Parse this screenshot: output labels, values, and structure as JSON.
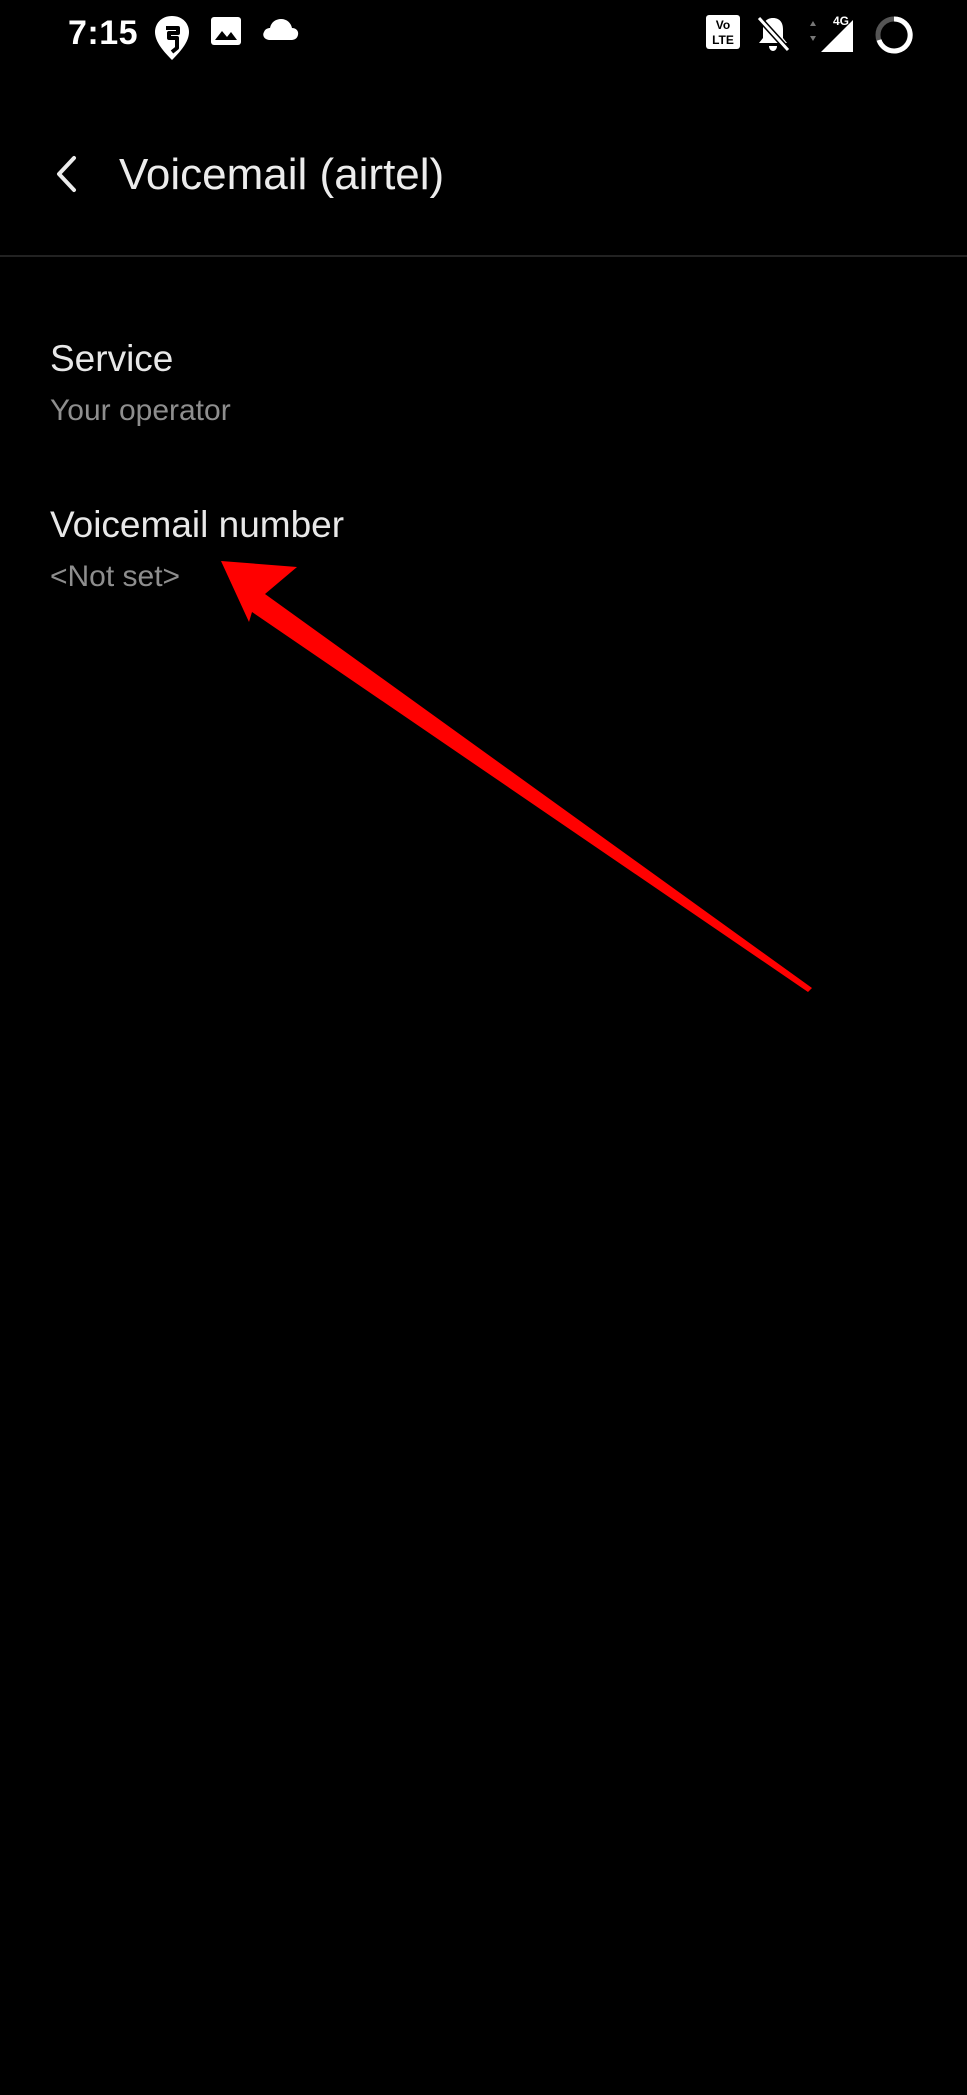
{
  "status_bar": {
    "time": "7:15",
    "network_label": "4G",
    "volte_label_top": "Vo",
    "volte_label_bottom": "LTE",
    "icons": [
      "swiggy-icon",
      "gallery-icon",
      "cloud-icon",
      "volte-icon",
      "notifications-muted-icon",
      "signal-icon",
      "battery-ring-icon"
    ]
  },
  "app_bar": {
    "back_icon": "chevron-left-icon",
    "title": "Voicemail (airtel)"
  },
  "preferences": [
    {
      "title": "Service",
      "summary": "Your operator"
    },
    {
      "title": "Voicemail number",
      "summary": "<Not set>"
    }
  ],
  "annotation": {
    "type": "red-arrow-pointing-at-voicemail-number",
    "color": "#ff0000"
  },
  "colors": {
    "background": "#000000",
    "title_text": "#ececec",
    "summary_text": "#8e8e8e"
  }
}
